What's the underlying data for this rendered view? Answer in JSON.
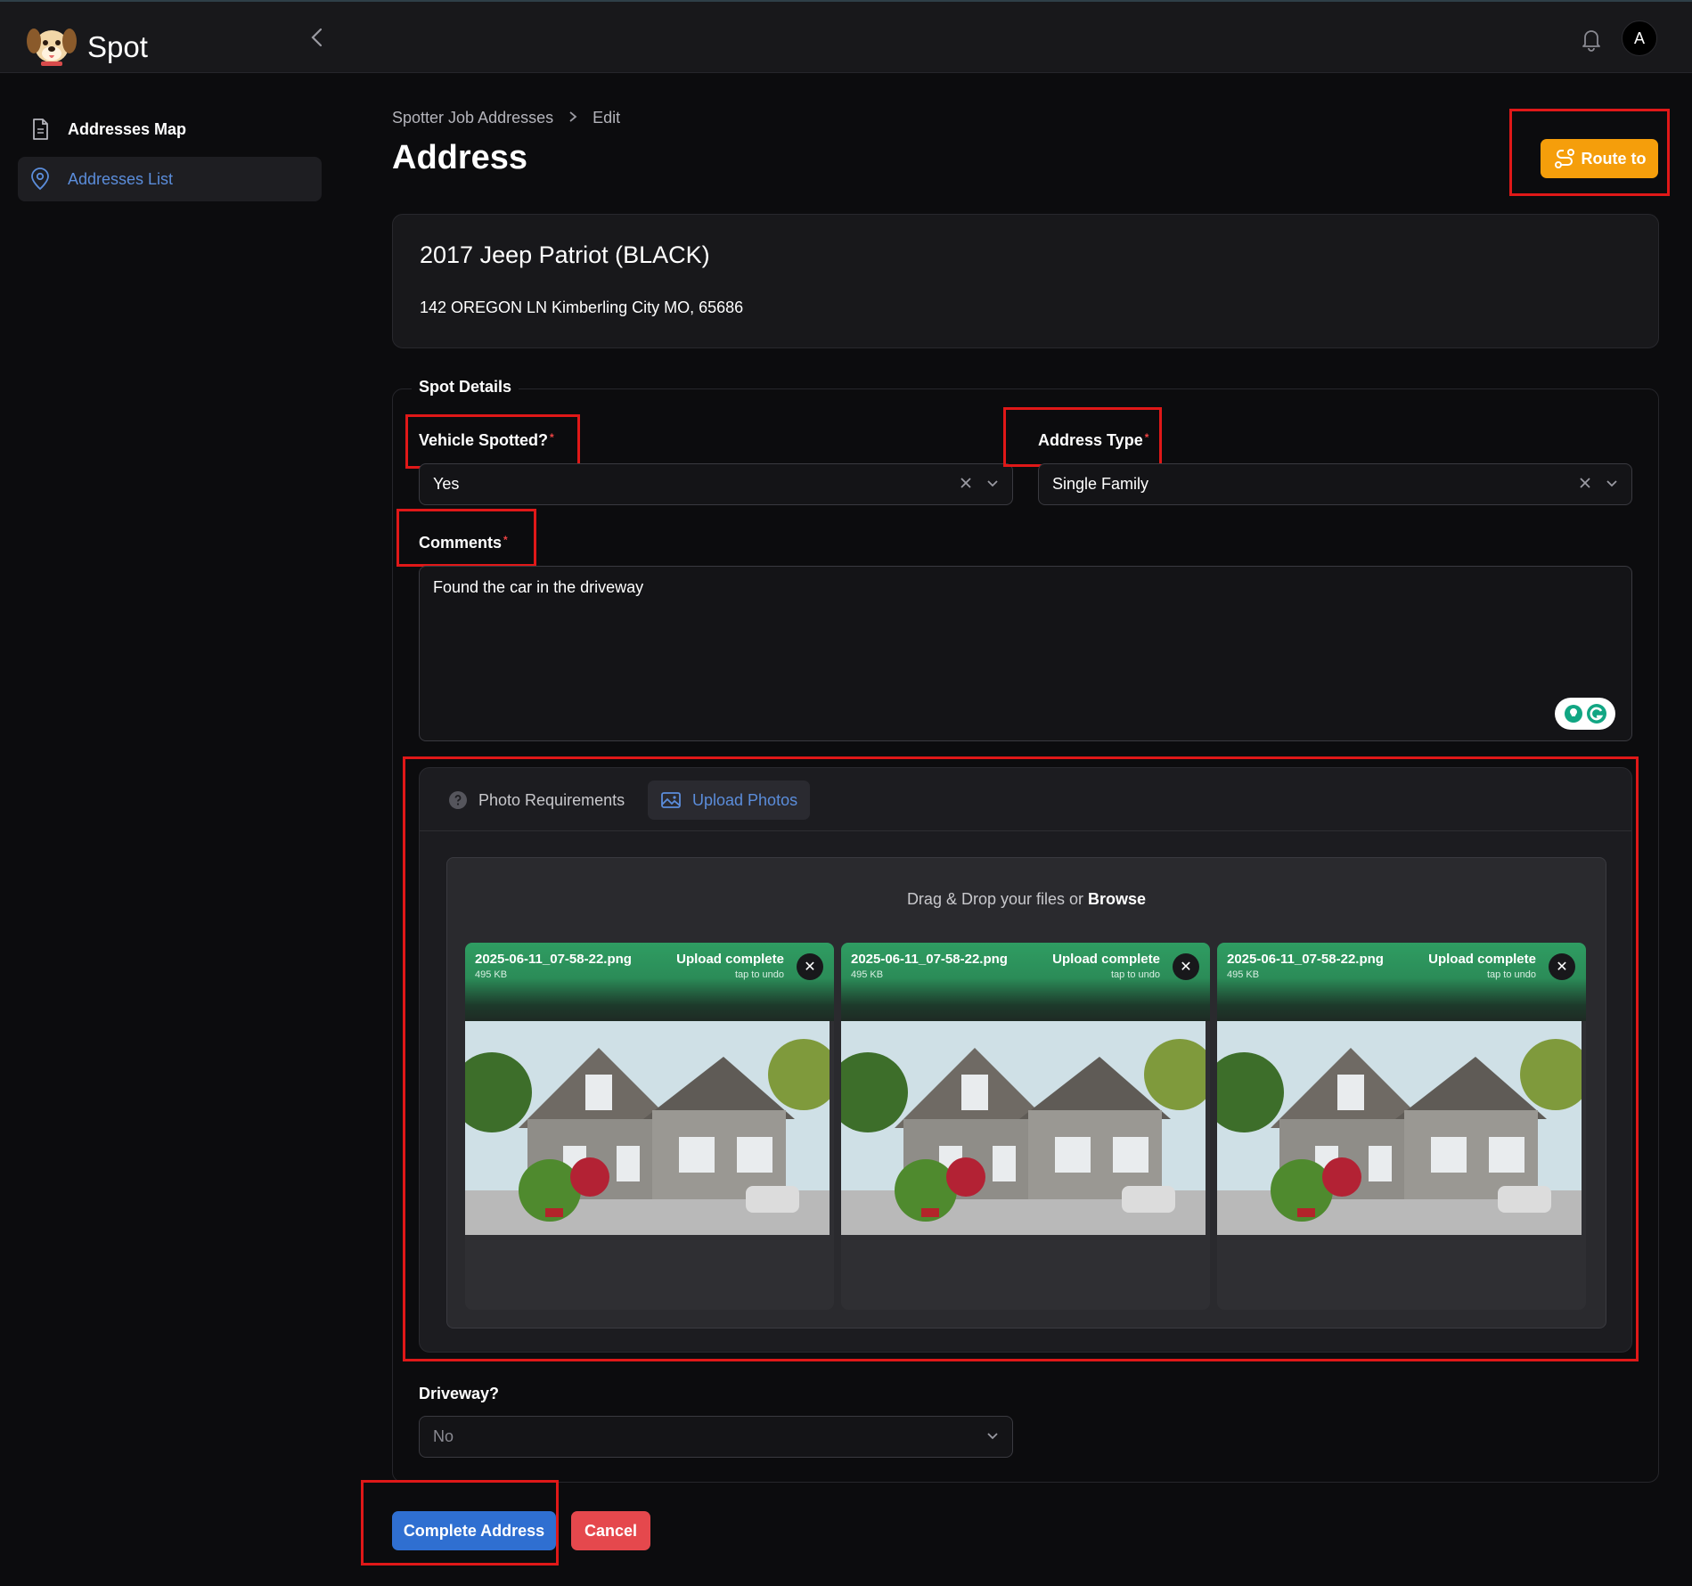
{
  "app": {
    "name": "Spot"
  },
  "header": {
    "avatar_initial": "A"
  },
  "sidebar": {
    "items": [
      {
        "label": "Addresses Map",
        "icon": "document-icon"
      },
      {
        "label": "Addresses List",
        "icon": "map-pin-icon",
        "active": true
      }
    ]
  },
  "breadcrumb": {
    "parent": "Spotter Job Addresses",
    "current": "Edit"
  },
  "page": {
    "title": "Address",
    "route_button": "Route to"
  },
  "vehicle": {
    "title": "2017 Jeep Patriot (BLACK)",
    "address": "142 OREGON LN Kimberling City MO, 65686"
  },
  "form": {
    "legend": "Spot Details",
    "vehicle_spotted": {
      "label": "Vehicle Spotted?",
      "value": "Yes"
    },
    "address_type": {
      "label": "Address Type",
      "value": "Single Family"
    },
    "comments": {
      "label": "Comments",
      "value": "Found the car in the driveway"
    },
    "driveway": {
      "label": "Driveway?",
      "value": "No"
    },
    "required_mark": "*"
  },
  "photos": {
    "tabs": [
      {
        "label": "Photo Requirements",
        "icon": "question-circle-icon"
      },
      {
        "label": "Upload Photos",
        "icon": "image-icon",
        "active": true
      }
    ],
    "drop_text": "Drag & Drop your files or",
    "browse": "Browse",
    "files": [
      {
        "name": "2025-06-11_07-58-22.png",
        "size": "495 KB",
        "status": "Upload complete",
        "undo": "tap to undo"
      },
      {
        "name": "2025-06-11_07-58-22.png",
        "size": "495 KB",
        "status": "Upload complete",
        "undo": "tap to undo"
      },
      {
        "name": "2025-06-11_07-58-22.png",
        "size": "495 KB",
        "status": "Upload complete",
        "undo": "tap to undo"
      }
    ]
  },
  "actions": {
    "complete": "Complete Address",
    "cancel": "Cancel"
  },
  "colors": {
    "accent": "#f59e0b",
    "primary": "#2f6fd1",
    "danger": "#e5484d",
    "upload_success": "#2f9d62",
    "annotation": "#e01818"
  }
}
